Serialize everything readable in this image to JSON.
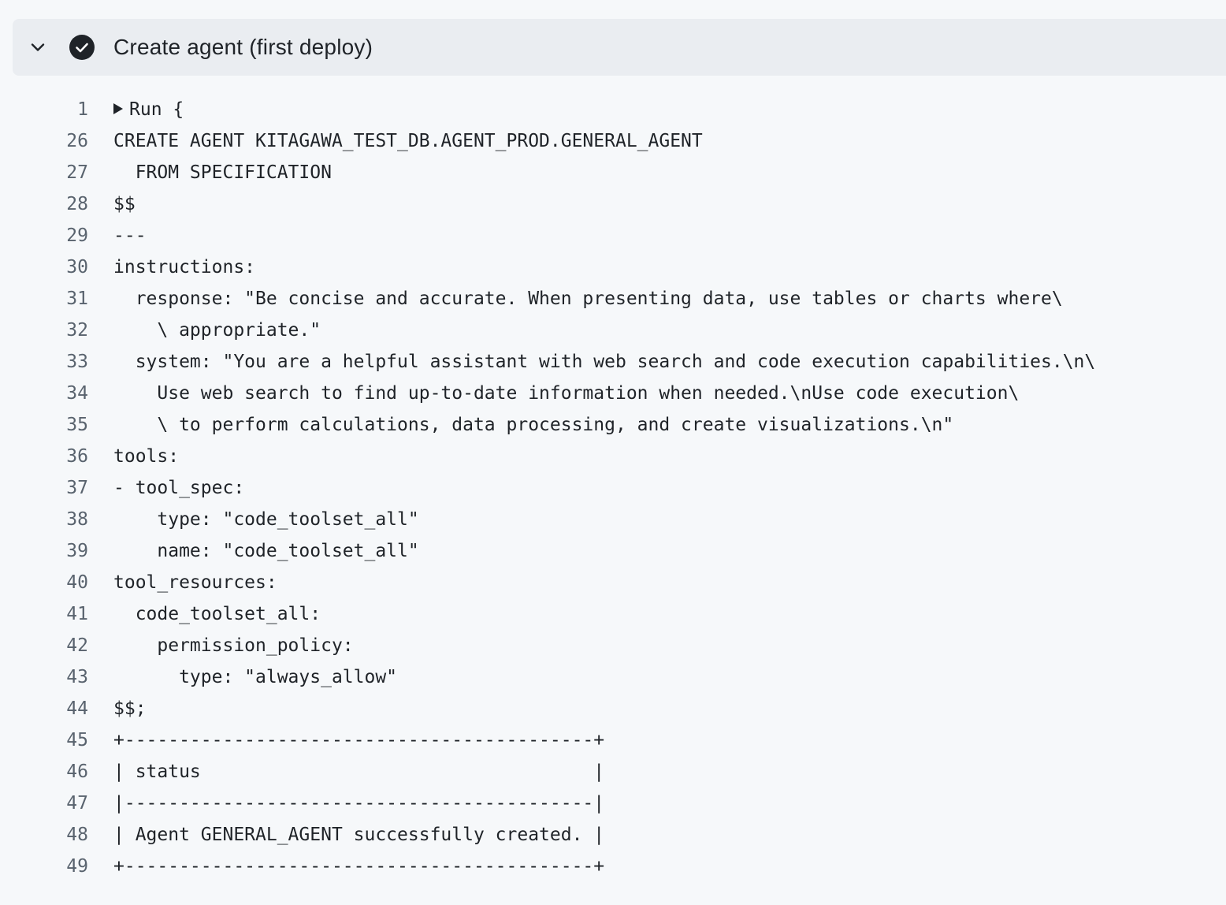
{
  "step": {
    "title": "Create agent (first deploy)",
    "status": "success",
    "expanded": true,
    "icons": {
      "toggle": "chevron-down-icon",
      "status": "check-circle-icon"
    },
    "colors": {
      "header_bg": "#eaedf1",
      "status_icon": "#1f2328"
    }
  },
  "log": {
    "run_group": {
      "line_number": "1",
      "label": "Run {",
      "collapsed": true
    },
    "lines": [
      {
        "n": "26",
        "text": "CREATE AGENT KITAGAWA_TEST_DB.AGENT_PROD.GENERAL_AGENT"
      },
      {
        "n": "27",
        "text": "  FROM SPECIFICATION"
      },
      {
        "n": "28",
        "text": "$$"
      },
      {
        "n": "29",
        "text": "---"
      },
      {
        "n": "30",
        "text": "instructions:"
      },
      {
        "n": "31",
        "text": "  response: \"Be concise and accurate. When presenting data, use tables or charts where\\"
      },
      {
        "n": "32",
        "text": "    \\ appropriate.\""
      },
      {
        "n": "33",
        "text": "  system: \"You are a helpful assistant with web search and code execution capabilities.\\n\\"
      },
      {
        "n": "34",
        "text": "    Use web search to find up-to-date information when needed.\\nUse code execution\\"
      },
      {
        "n": "35",
        "text": "    \\ to perform calculations, data processing, and create visualizations.\\n\""
      },
      {
        "n": "36",
        "text": "tools:"
      },
      {
        "n": "37",
        "text": "- tool_spec:"
      },
      {
        "n": "38",
        "text": "    type: \"code_toolset_all\""
      },
      {
        "n": "39",
        "text": "    name: \"code_toolset_all\""
      },
      {
        "n": "40",
        "text": "tool_resources:"
      },
      {
        "n": "41",
        "text": "  code_toolset_all:"
      },
      {
        "n": "42",
        "text": "    permission_policy:"
      },
      {
        "n": "43",
        "text": "      type: \"always_allow\""
      },
      {
        "n": "44",
        "text": "$$;"
      },
      {
        "n": "45",
        "text": "+-------------------------------------------+"
      },
      {
        "n": "46",
        "text": "| status                                    |"
      },
      {
        "n": "47",
        "text": "|-------------------------------------------|"
      },
      {
        "n": "48",
        "text": "| Agent GENERAL_AGENT successfully created. |"
      },
      {
        "n": "49",
        "text": "+-------------------------------------------+"
      }
    ]
  }
}
